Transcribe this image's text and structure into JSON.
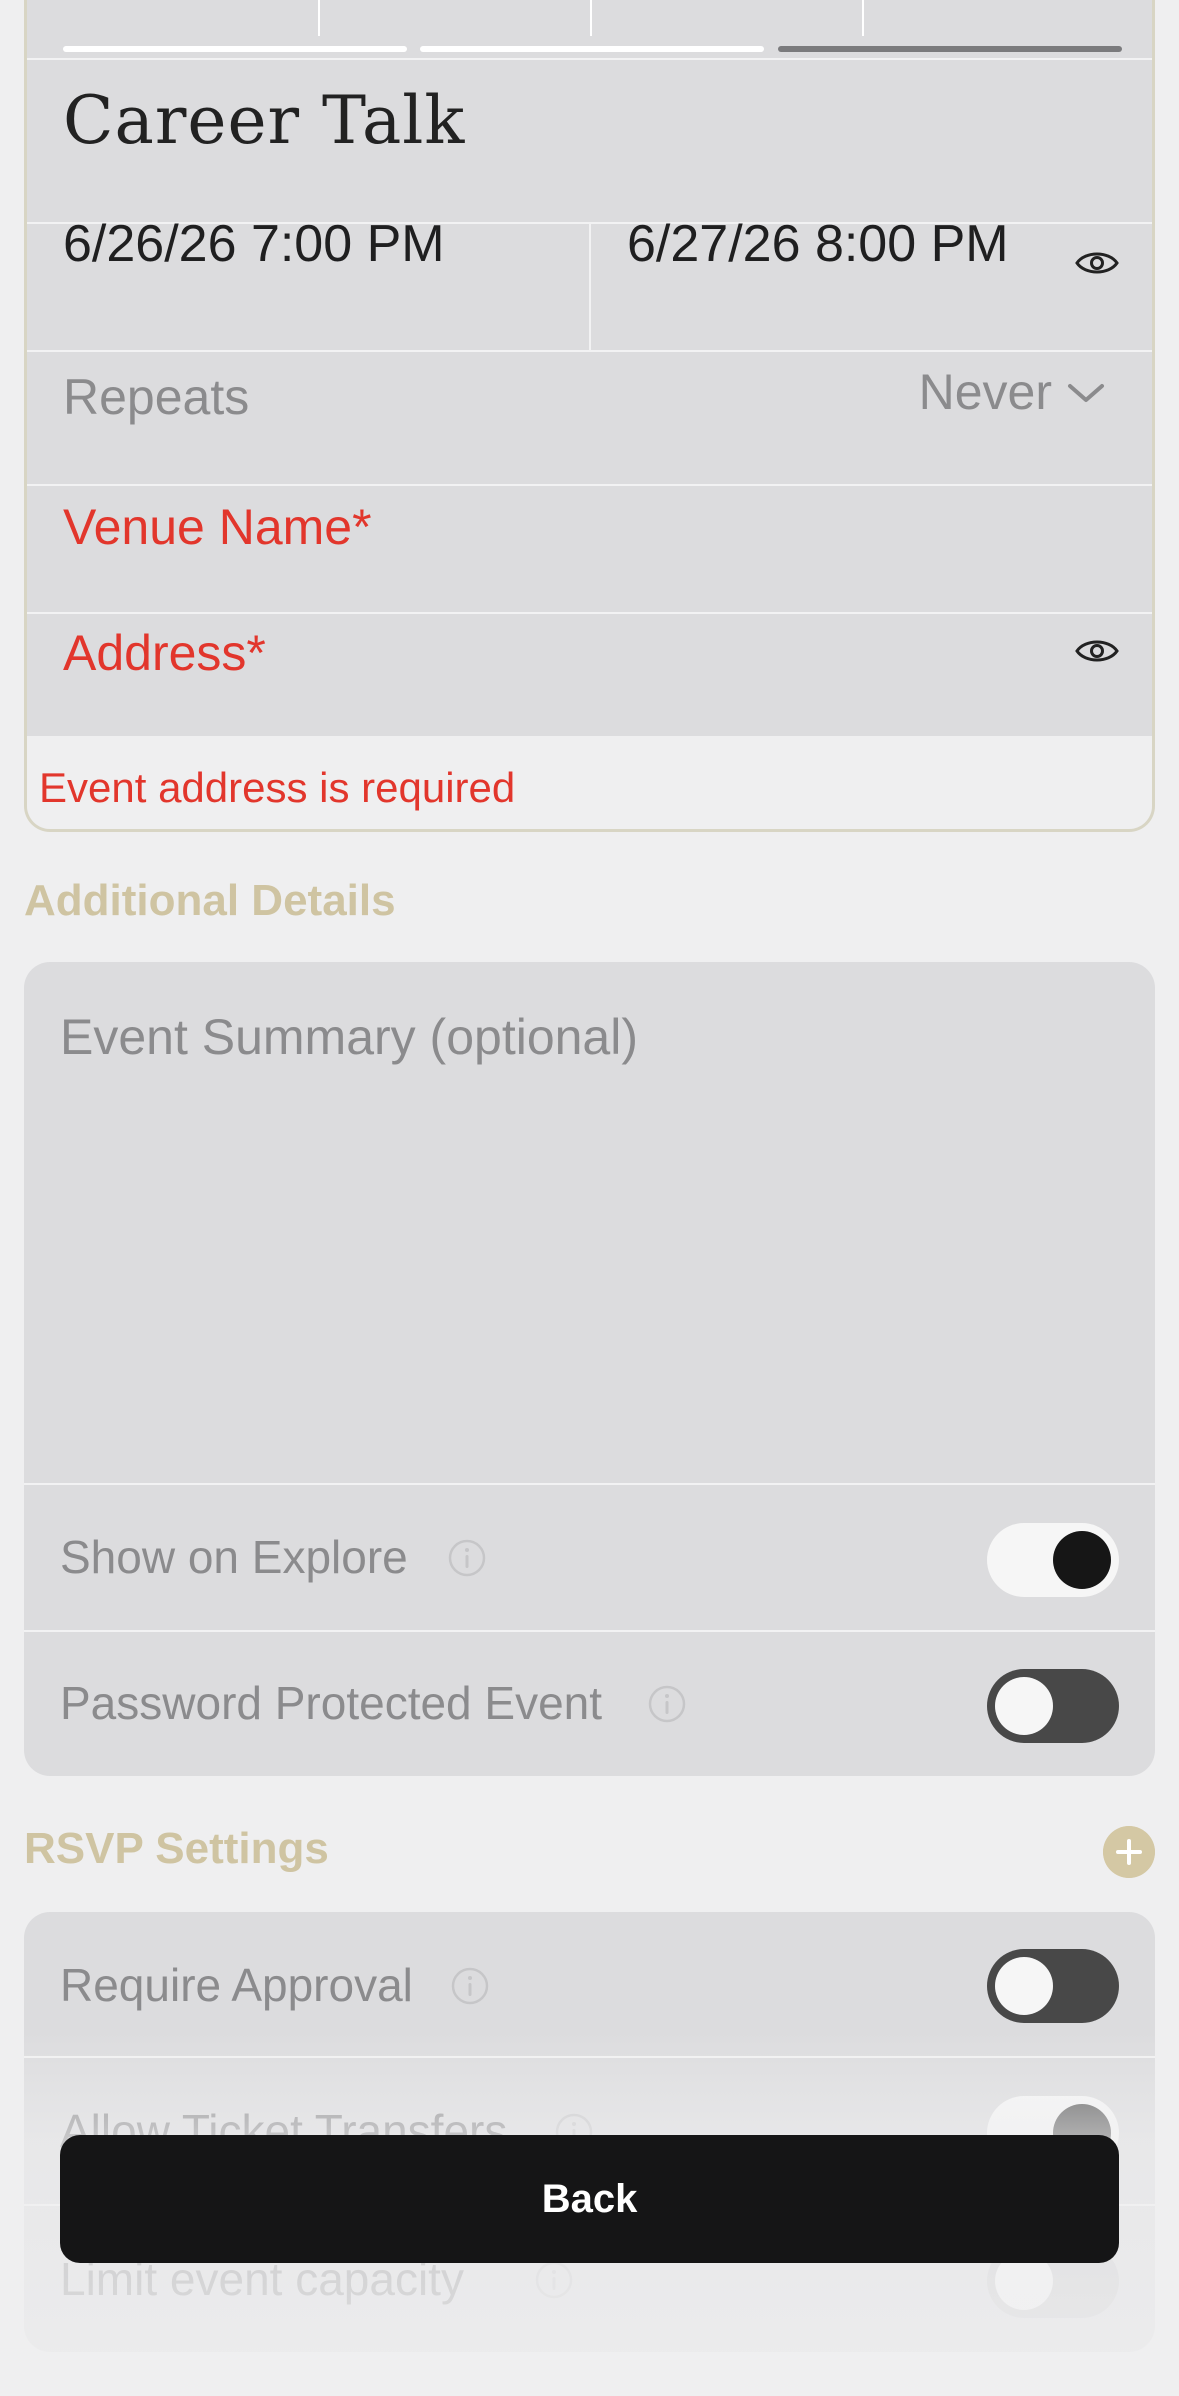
{
  "event": {
    "title": "Career Talk",
    "start_datetime": "6/26/26 7:00 PM",
    "end_datetime": "6/27/26 8:00 PM",
    "repeats_label": "Repeats",
    "repeats_value": "Never",
    "venue_placeholder": "Venue Name*",
    "address_placeholder": "Address*",
    "address_error": "Event address is required"
  },
  "progress": {
    "steps_total": 3,
    "current_step": 3
  },
  "additional_details": {
    "heading": "Additional Details",
    "summary_placeholder": "Event Summary (optional)",
    "show_on_explore": {
      "label": "Show on Explore",
      "on": true
    },
    "password_protected": {
      "label": "Password Protected Event",
      "on": false
    }
  },
  "rsvp": {
    "heading": "RSVP Settings",
    "require_approval": {
      "label": "Require Approval",
      "on": false
    },
    "allow_transfers": {
      "label": "Allow Ticket Transfers",
      "on": true
    },
    "limit_capacity": {
      "label": "Limit event capacity",
      "on": false
    }
  },
  "footer": {
    "back_label": "Back"
  },
  "colors": {
    "error": "#e2362c",
    "accent": "#cfc4a2",
    "card": "#dcdcde",
    "background": "#efeff0",
    "button": "#151516"
  },
  "icons": {
    "visibility": "eye-icon",
    "dropdown": "chevron-down-icon",
    "info": "info-icon",
    "add": "plus-icon"
  }
}
